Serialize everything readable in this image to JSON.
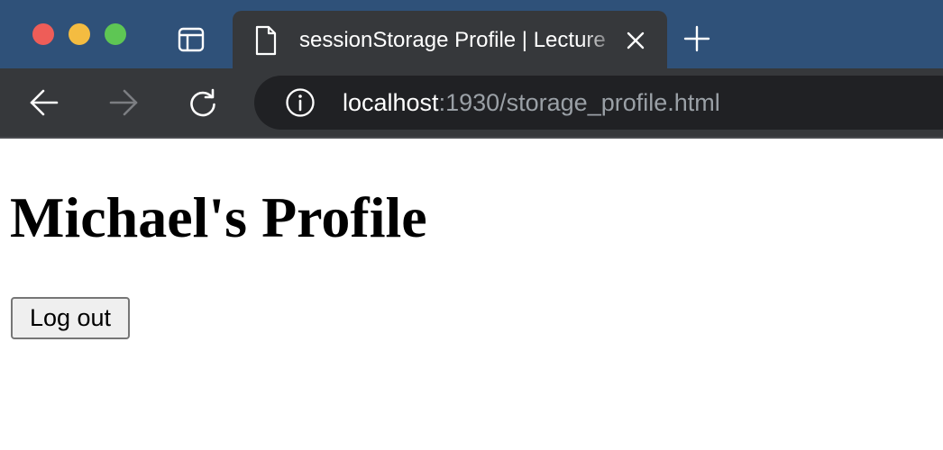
{
  "browser": {
    "tab": {
      "title": "sessionStorage Profile | Lecture"
    },
    "address_bar": {
      "host": "localhost",
      "rest": ":1930/storage_profile.html"
    }
  },
  "page": {
    "heading": "Michael's Profile",
    "logout_label": "Log out"
  },
  "colors": {
    "tab_strip": "#2f5179",
    "toolbar": "#36383b",
    "omnibox": "#202124",
    "traffic_close": "#ee5d58",
    "traffic_minimize": "#f4bc41",
    "traffic_maximize": "#5ec654"
  },
  "icons": {
    "sidebar": "sidebar-icon",
    "tab_page": "page-icon",
    "tab_close": "close-icon",
    "new_tab": "plus-icon",
    "back": "arrow-left-icon",
    "forward": "arrow-right-icon",
    "reload": "reload-icon",
    "site_info": "info-icon"
  }
}
